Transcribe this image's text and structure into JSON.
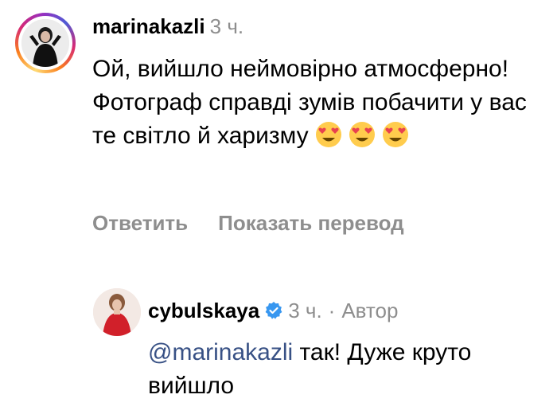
{
  "comment_1": {
    "username": "marinakazli",
    "time": "3 ч.",
    "text": "Ой, вийшло неймовірно атмосферно! Фотограф справді зумів побачити у вас те світло й харизму",
    "emoji_icons": [
      "heart-eyes-icon",
      "heart-eyes-icon",
      "heart-eyes-icon"
    ]
  },
  "actions": {
    "reply": "Ответить",
    "show_translation": "Показать перевод"
  },
  "reply_1": {
    "username": "cybulskaya",
    "time": "3 ч.",
    "separator": "·",
    "author_label": "Автор",
    "mention": "@marinakazli",
    "text": "так! Дуже круто вийшло"
  },
  "colors": {
    "text": "#000000",
    "secondary": "#8e8e8e",
    "mention": "#385185",
    "verified": "#3897f0"
  }
}
